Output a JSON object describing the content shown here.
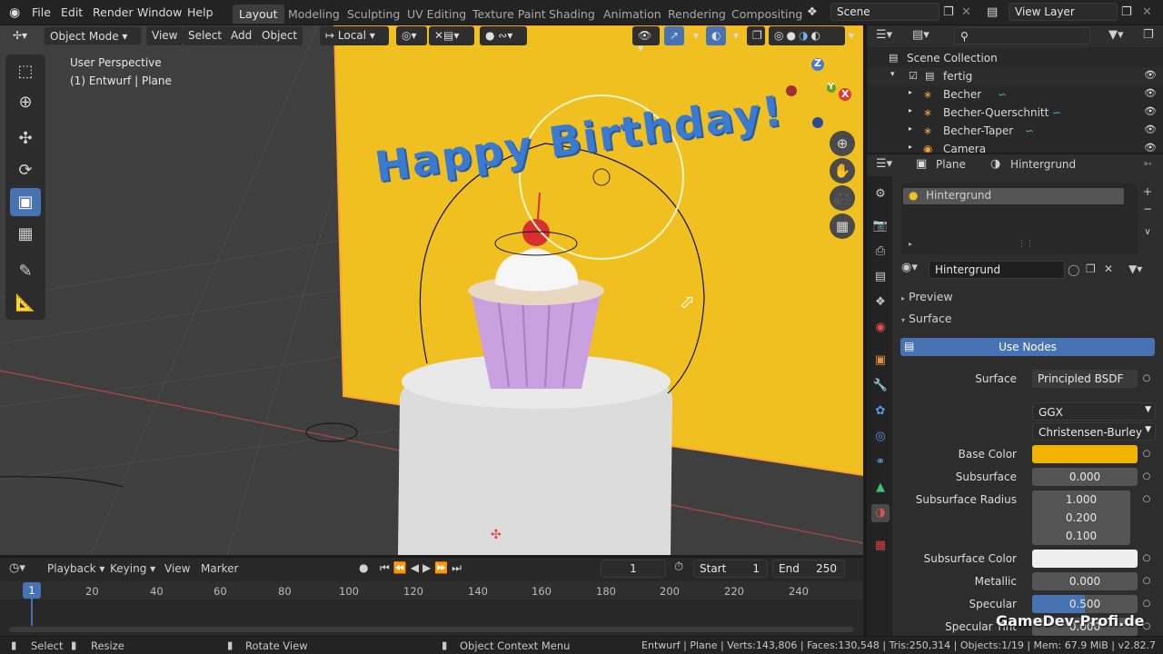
{
  "topbar": {
    "menus": [
      "File",
      "Edit",
      "Render",
      "Window",
      "Help"
    ],
    "workspaces": [
      "Layout",
      "Modeling",
      "Sculpting",
      "UV Editing",
      "Texture Paint",
      "Shading",
      "Animation",
      "Rendering",
      "Compositing"
    ],
    "scene": "Scene",
    "view_layer": "View Layer"
  },
  "viewport": {
    "mode": "Object Mode",
    "menus": [
      "View",
      "Select",
      "Add",
      "Object"
    ],
    "orientation": "Local",
    "perspective": "User Perspective",
    "context": "(1) Entwurf | Plane",
    "scene_text": "Happy Birthday!",
    "axes": [
      "X",
      "Y",
      "Z"
    ],
    "colors": {
      "bg": "#3f3f3f",
      "wall": "#f0c020",
      "accent": "#4772b3",
      "text3d": "#3a7ad0"
    }
  },
  "outliner": {
    "root": "Scene Collection",
    "collection": "fertig",
    "items": [
      "Becher",
      "Becher-Querschnitt",
      "Becher-Taper",
      "Camera"
    ]
  },
  "properties": {
    "object": "Plane",
    "material": "Hintergrund",
    "slot": "Hintergrund",
    "panel_preview": "Preview",
    "panel_surface": "Surface",
    "use_nodes": "Use Nodes",
    "surface_label": "Surface",
    "surface_value": "Principled BSDF",
    "distribution": "GGX",
    "subsurface_method": "Christensen-Burley",
    "rows": [
      {
        "label": "Base Color",
        "value": ""
      },
      {
        "label": "Subsurface",
        "value": "0.000"
      },
      {
        "label": "Subsurface Radius",
        "value": "1.000"
      },
      {
        "label": "",
        "value": "0.200"
      },
      {
        "label": "",
        "value": "0.100"
      },
      {
        "label": "Subsurface Color",
        "value": ""
      },
      {
        "label": "Metallic",
        "value": "0.000"
      },
      {
        "label": "Specular",
        "value": "0.500"
      },
      {
        "label": "Specular Tint",
        "value": "0.000"
      }
    ],
    "specular_fill": 0.5,
    "base_color": "#f0b400",
    "subsurface_color": "#eeeeee"
  },
  "timeline": {
    "menus": [
      "Playback",
      "Keying",
      "View",
      "Marker"
    ],
    "current": "1",
    "start_label": "Start",
    "start": "1",
    "end_label": "End",
    "end": "250",
    "ticks": [
      "20",
      "40",
      "60",
      "80",
      "100",
      "120",
      "140",
      "160",
      "180",
      "200",
      "220",
      "240"
    ],
    "marker": "1"
  },
  "status": {
    "select": "Select",
    "resize": "Resize",
    "rotate": "Rotate View",
    "context_menu": "Object Context Menu",
    "stats": "Entwurf | Plane | Verts:143,806 | Faces:130,548 | Tris:250,314 | Objects:1/19 | Mem: 67.9 MiB | v2.82.7"
  },
  "watermark": "GameDev-Profi.de"
}
